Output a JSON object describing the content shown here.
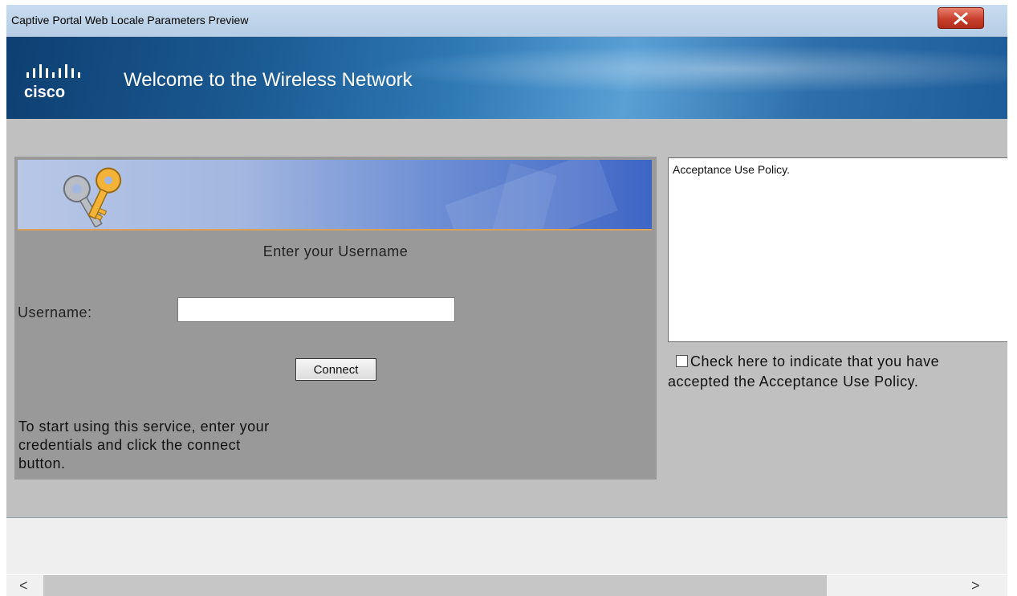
{
  "window": {
    "title": "Captive Portal Web Locale Parameters Preview",
    "close_icon": "close-icon"
  },
  "banner": {
    "logo_text": "cisco",
    "welcome": "Welcome to the Wireless Network",
    "logo_icon": "cisco-logo-icon"
  },
  "login": {
    "header_icon": "keys-icon",
    "prompt": "Enter your Username",
    "username_label": "Username:",
    "username_value": "",
    "connect_label": "Connect",
    "info_line1": "To start using this service, enter your",
    "info_line2": "credentials and click the connect",
    "info_line3": "button."
  },
  "aup": {
    "text": "Acceptance Use Policy.",
    "check_line1": "Check here to indicate that you have",
    "check_line2": "accepted the Acceptance Use Policy.",
    "checked": false
  },
  "scrollbar": {
    "left_icon": "chevron-left-icon",
    "right_icon": "chevron-right-icon",
    "left_glyph": "<",
    "right_glyph": ">"
  },
  "colors": {
    "banner": "#1b5a92",
    "panel": "#999999",
    "background": "#c0c0c0",
    "close": "#c7402d"
  }
}
